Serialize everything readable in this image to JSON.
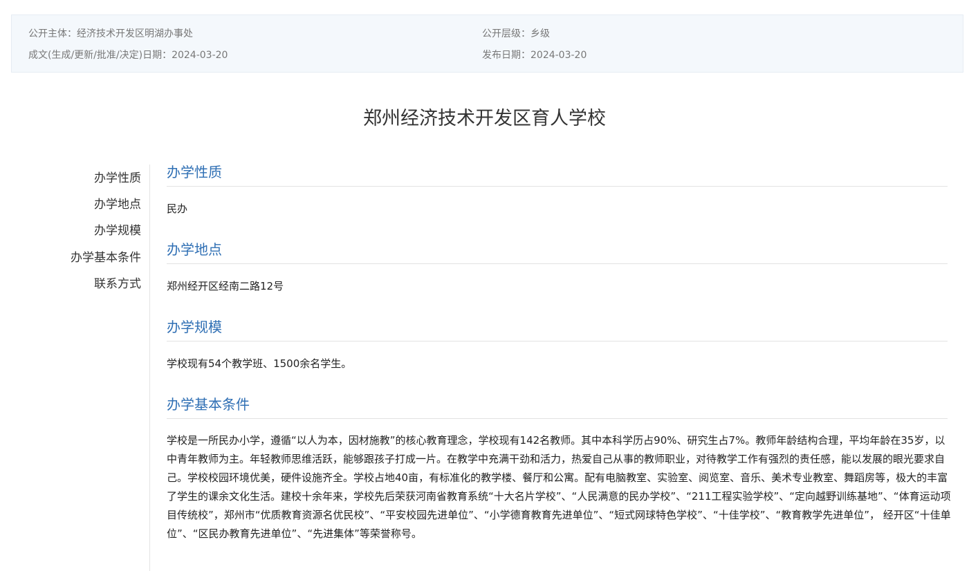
{
  "meta": {
    "publisher_label": "公开主体：",
    "publisher_value": "经济技术开发区明湖办事处",
    "level_label": "公开层级：",
    "level_value": "乡级",
    "written_date_label": "成文(生成/更新/批准/决定)日期：",
    "written_date_value": "2024-03-20",
    "publish_date_label": "发布日期：",
    "publish_date_value": "2024-03-20"
  },
  "title": "郑州经济技术开发区育人学校",
  "nav": {
    "items": [
      {
        "label": "办学性质"
      },
      {
        "label": "办学地点"
      },
      {
        "label": "办学规模"
      },
      {
        "label": "办学基本条件"
      },
      {
        "label": "联系方式"
      }
    ]
  },
  "sections": [
    {
      "heading": "办学性质",
      "body": "民办"
    },
    {
      "heading": "办学地点",
      "body": "郑州经开区经南二路12号"
    },
    {
      "heading": "办学规模",
      "body": "学校现有54个教学班、1500余名学生。"
    },
    {
      "heading": "办学基本条件",
      "body": "学校是一所民办小学，遵循“以人为本，因材施教”的核心教育理念，学校现有142名教师。其中本科学历占90%、研究生占7%。教师年龄结构合理，平均年龄在35岁，以中青年教师为主。年轻教师思维活跃，能够跟孩子打成一片。在教学中充满干劲和活力，热爱自己从事的教师职业，对待教学工作有强烈的责任感，能以发展的眼光要求自己。学校校园环境优美，硬件设施齐全。学校占地40亩，有标准化的教学楼、餐厅和公寓。配有电脑教室、实验室、阅览室、音乐、美术专业教室、舞蹈房等，极大的丰富了学生的课余文化生活。建校十余年来，学校先后荣获河南省教育系统“十大名片学校”、“人民满意的民办学校”、“211工程实验学校”、“定向越野训练基地”、“体育运动项目传统校”，郑州市“优质教育资源名优民校”、“平安校园先进单位”、“小学德育教育先进单位”、“短式网球特色学校”、“十佳学校”、“教育教学先进单位”， 经开区“十佳单位”、“区民办教育先进单位”、“先进集体”等荣誉称号。"
    }
  ]
}
